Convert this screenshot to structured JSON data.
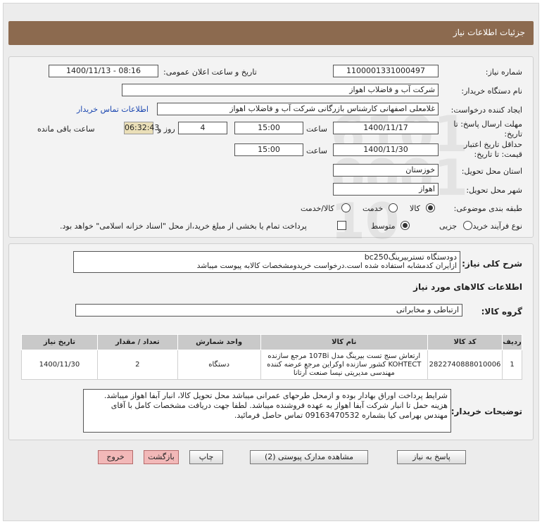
{
  "header": {
    "title": "جزئیات اطلاعات نیاز"
  },
  "fields": {
    "need_number_label": "شماره نیاز:",
    "need_number": "1100001331000497",
    "announce_label": "تاریخ و ساعت اعلان عمومی:",
    "announce_value": "1400/11/13 - 08:16",
    "buyer_label": "نام دستگاه خریدار:",
    "buyer_value": "شرکت آب و فاضلاب اهواز",
    "creator_label": "ایجاد کننده درخواست:",
    "creator_value": "غلامعلی اصفهانی کارشناس بازرگانی شرکت آب و فاضلاب اهواز",
    "contact_link": "اطلاعات تماس خریدار",
    "deadline_label_1": "مهلت ارسال پاسخ: تا",
    "deadline_label_2": "تاریخ:",
    "deadline_date": "1400/11/17",
    "time_label": "ساعت",
    "deadline_time": "15:00",
    "days_value": "4",
    "days_label": "روز و",
    "remaining_time": "06:32:43",
    "remaining_label": "ساعت باقی مانده",
    "validity_label_1": "حداقل تاریخ اعتبار",
    "validity_label_2": "قیمت: تا تاریخ:",
    "validity_date": "1400/11/30",
    "validity_time": "15:00",
    "province_label": "استان محل تحویل:",
    "province_value": "خوزستان",
    "city_label": "شهر محل تحویل:",
    "city_value": "اهواز",
    "category_label": "طبقه بندی موضوعی:",
    "category_options": [
      "کالا",
      "خدمت",
      "کالا/خدمت"
    ],
    "process_label": "نوع فرآیند خرید :",
    "process_options": [
      "جزیی",
      "متوسط"
    ],
    "payment_note": "پرداخت تمام یا بخشی از مبلغ خرید،از محل \"اسناد خزانه اسلامی\" خواهد بود."
  },
  "summary": {
    "label": "شرح کلی نیاز:",
    "line1": "دودستگاه تستربیرینگbc250",
    "line2": "ازایران کدمشابه استفاده شده است.درخواست خریدومشخصات کالابه پیوست میباشد"
  },
  "goods": {
    "section_title": "اطلاعات کالاهای مورد نیاز",
    "group_label": "گروه کالا:",
    "group_value": "ارتباطی و مخابراتی",
    "columns": [
      "ردیف",
      "کد کالا",
      "نام کالا",
      "واحد شمارش",
      "تعداد / مقدار",
      "تاریخ نیاز"
    ],
    "rows": [
      {
        "index": "1",
        "code": "2822740888010006",
        "name": "ارتعاش سنج تست بیرینگ مدل 107Bi مرجع سازنده KOHTECT کشور سازنده اوکراین مرجع عرضه کننده مهندسی مدیریتی نیسا صنعت آرتانا",
        "unit": "دستگاه",
        "qty": "2",
        "date": "1400/11/30"
      }
    ]
  },
  "buyer_notes": {
    "label": "توضیحات خریدار:",
    "text": "شرایط پرداخت اوراق بهادار بوده و ازمحل طرحهای عمرانی میباشد محل تحویل کالا، انبار آبفا اهواز میباشد. هزینه حمل تا انبار شرکت آبفا اهواز به عهده فروشنده میباشد. لطفا جهت دریافت مشخصات کامل با آقای مهندس بهرامی کیا بشماره 09163470532 تماس حاصل فرمائید."
  },
  "buttons": {
    "reply": "پاسخ به نیاز",
    "attachments": "مشاهده مدارک پیوستی (2)",
    "print": "چاپ",
    "back": "بازگشت",
    "exit": "خروج"
  }
}
